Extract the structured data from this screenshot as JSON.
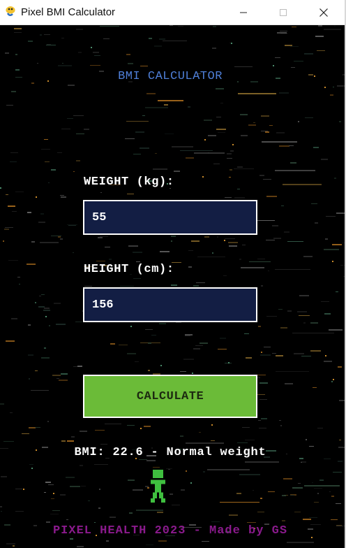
{
  "window": {
    "title": "Pixel BMI Calculator",
    "app_icon": "pygame-snake-icon",
    "controls": [
      "minimize-icon",
      "maximize-icon",
      "close-icon"
    ]
  },
  "app": {
    "heading": "BMI CALCULATOR",
    "weight": {
      "label": "WEIGHT (kg):",
      "value": "55"
    },
    "height": {
      "label": "HEIGHT (cm):",
      "value": "156"
    },
    "calculate_label": "CALCULATE",
    "result": "BMI: 22.6 - Normal weight",
    "status_sprite": "green-pixel-person-icon",
    "footer": "PIXEL HEALTH 2023 - Made by GS"
  },
  "colors": {
    "heading": "#4f7fd8",
    "input_bg": "#131e44",
    "button_bg": "#6bbb38",
    "sprite": "#3fbf3f",
    "footer": "#8a1a8c",
    "background": "#000000"
  }
}
